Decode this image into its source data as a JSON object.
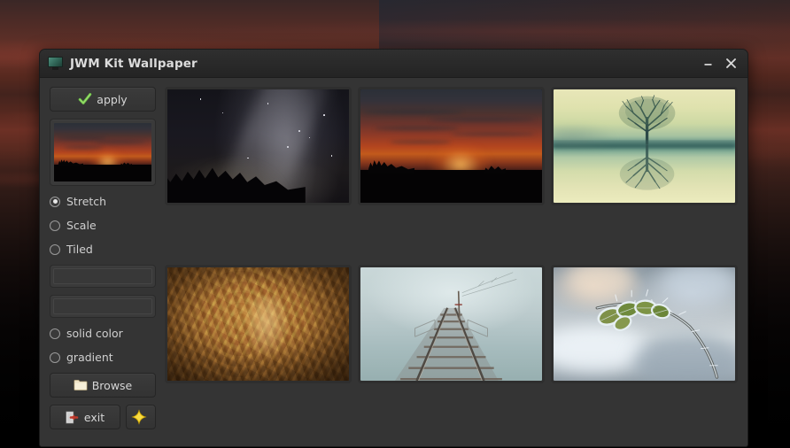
{
  "desktop": {
    "name": "sunset-wallpaper-desktop"
  },
  "window": {
    "title": "JWM Kit Wallpaper",
    "icon": "monitor-icon",
    "minimize_label": "–",
    "close_label": "✕"
  },
  "left_panel": {
    "apply_label": "apply",
    "apply_icon": "green-check-icon",
    "preview_alt": "current wallpaper preview",
    "mode_options": [
      {
        "label": "Stretch",
        "selected": true
      },
      {
        "label": "Scale",
        "selected": false
      },
      {
        "label": "Tiled",
        "selected": false
      }
    ],
    "fields": [
      {
        "name": "color-field-1",
        "value": "",
        "placeholder": ""
      },
      {
        "name": "color-field-2",
        "value": "",
        "placeholder": ""
      }
    ],
    "fill_options": [
      {
        "label": "solid color",
        "selected": false
      },
      {
        "label": "gradient",
        "selected": false
      }
    ],
    "browse_label": "Browse",
    "browse_icon": "folder-icon",
    "exit_label": "exit",
    "exit_icon": "exit-door-icon",
    "star_label": "",
    "star_icon": "sparkle-star-icon"
  },
  "gallery": {
    "thumbnails": [
      {
        "name": "thumb-milky-way",
        "alt": "Milky Way over tree silhouettes"
      },
      {
        "name": "thumb-red-sunset",
        "alt": "Red sunset over field horizon"
      },
      {
        "name": "thumb-lone-tree",
        "alt": "Lone tree reflected in still water"
      },
      {
        "name": "thumb-mayan-carving",
        "alt": "Mayan stone relief carving"
      },
      {
        "name": "thumb-foggy-railway",
        "alt": "Railway tracks vanishing into fog"
      },
      {
        "name": "thumb-frosted-branch",
        "alt": "Frost covered branch with green leaves"
      }
    ]
  },
  "colors": {
    "window_bg": "#343434",
    "titlebar_bg": "#2c2c2c",
    "button_bg": "#373737",
    "text": "#cfcfcf",
    "accent_green": "#6fc04a",
    "accent_yellow": "#e8c21a",
    "accent_red": "#c0392b"
  }
}
